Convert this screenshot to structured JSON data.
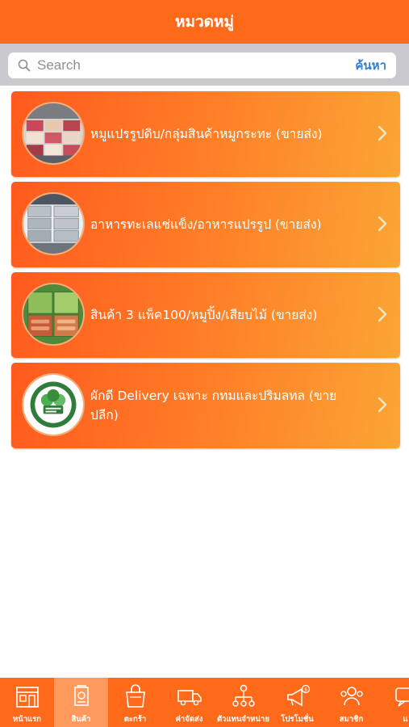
{
  "header": {
    "title": "หมวดหมู่"
  },
  "search": {
    "placeholder": "Search",
    "button_label": "ค้นหา"
  },
  "categories": [
    {
      "label": "หมูแปรรูปดิบ/กลุ่มสินค้าหมูกระทะ (ขายส่ง)",
      "thumbnail": "frozen-meat-display-image"
    },
    {
      "label": "อาหารทะเลแช่แข็ง/อาหารแปรรูป (ขายส่ง)",
      "thumbnail": "stacked-crates-image"
    },
    {
      "label": "สินค้า 3 แพ็ค100/หมูปิ้ง/เสียบไม้ (ขายส่ง)",
      "thumbnail": "packaged-sausage-image"
    },
    {
      "label": "ผักดี Delivery เฉพาะ กทมและปริมลทล (ขายปลีก)",
      "thumbnail": "pakdee-logo-image"
    }
  ],
  "tabbar": {
    "items": [
      {
        "label": "หน้าแรก",
        "icon": "home-icon",
        "active": false
      },
      {
        "label": "สินค้า",
        "icon": "product-icon",
        "active": true
      },
      {
        "label": "ตะกร้า",
        "icon": "basket-icon",
        "active": false
      },
      {
        "label": "ค่าจัดส่ง",
        "icon": "delivery-truck-icon",
        "active": false
      },
      {
        "label": "ตัวแทนจำหน่าย",
        "icon": "agent-network-icon",
        "active": false
      },
      {
        "label": "โปรโมชั่น",
        "icon": "megaphone-icon",
        "active": false
      },
      {
        "label": "สมาชิก",
        "icon": "members-icon",
        "active": false
      },
      {
        "label": "แ",
        "icon": "chat-icon",
        "active": false
      }
    ]
  },
  "colors": {
    "header": "#ff6a1a",
    "card_gradient_start": "#ff5a1e",
    "card_gradient_end": "#fba535",
    "search_button": "#2f7fd6",
    "tab_active": "#ff9a5c"
  }
}
